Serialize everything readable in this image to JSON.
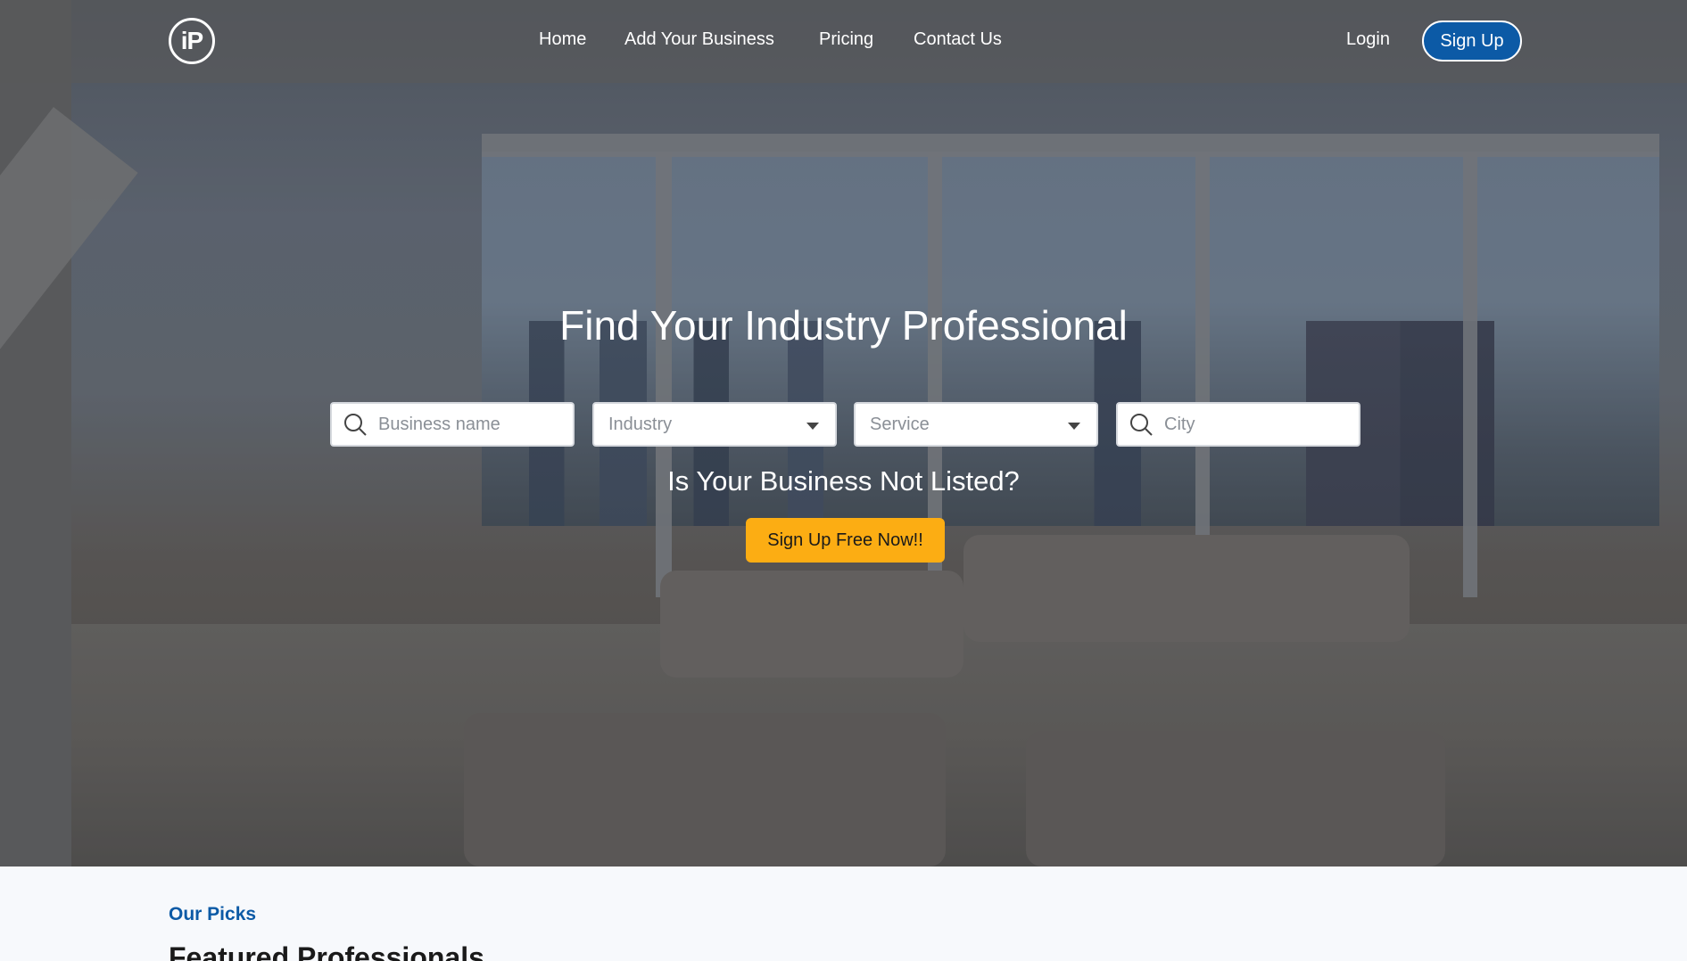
{
  "brand": {
    "logo_text": "iP"
  },
  "nav": {
    "items": [
      "Home",
      "Add Your Business",
      "Pricing",
      "Contact Us"
    ],
    "login": "Login",
    "signup": "Sign Up"
  },
  "hero": {
    "title": "Find Your Industry Professional",
    "search": {
      "business_placeholder": "Business name",
      "industry_placeholder": "Industry",
      "service_placeholder": "Service",
      "city_placeholder": "City"
    },
    "subtitle": "Is Your Business Not Listed?",
    "cta": "Sign Up Free Now!!"
  },
  "section": {
    "eyebrow": "Our Picks",
    "title": "Featured Professionals"
  },
  "colors": {
    "primary": "#0c5aa6",
    "accent": "#fcad13"
  },
  "icons": [
    "search-icon",
    "chevron-down-icon"
  ]
}
